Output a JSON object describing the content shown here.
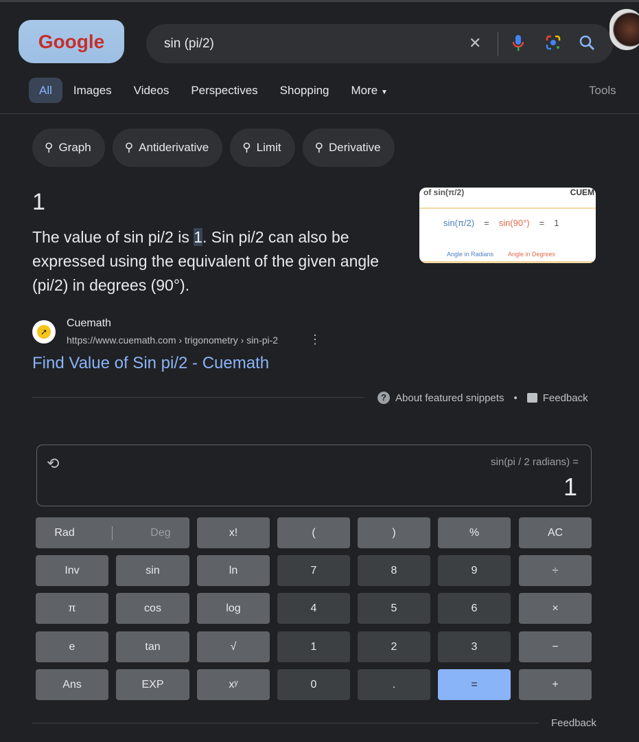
{
  "header": {
    "logo_text": "Google",
    "query": "sin (pi/2)",
    "icons": [
      "clear-icon",
      "mic-icon",
      "lens-icon",
      "search-icon"
    ]
  },
  "tabs": [
    {
      "label": "All",
      "active": true
    },
    {
      "label": "Images"
    },
    {
      "label": "Videos"
    },
    {
      "label": "Perspectives"
    },
    {
      "label": "Shopping"
    },
    {
      "label": "More"
    }
  ],
  "tools_label": "Tools",
  "chips": [
    "Graph",
    "Antiderivative",
    "Limit",
    "Derivative"
  ],
  "snippet": {
    "answer": "1",
    "text_before": "The value of sin pi/2 is ",
    "highlight": "1",
    "text_after": ". Sin pi/2 can also be expressed using the equivalent of the given angle (pi/2) in degrees (90°).",
    "image": {
      "top": "of sin(π/2)",
      "brand": "CUEM",
      "formula_left": "sin(π/2)",
      "eq": "=",
      "formula_mid": "sin(90°)",
      "formula_right": "1",
      "label_rad": "Angle in Radians",
      "label_deg": "Angle in Degrees"
    },
    "source_name": "Cuemath",
    "source_url": "https://www.cuemath.com › trigonometry › sin-pi-2",
    "link_title": "Find Value of Sin pi/2 - Cuemath",
    "about": "About featured snippets",
    "dot": "•",
    "feedback": "Feedback"
  },
  "calculator": {
    "expression": "sin(pi / 2 radians) =",
    "result": "1",
    "rad": "Rad",
    "deg": "Deg",
    "buttons": [
      [
        "x!",
        "(",
        ")",
        "%",
        "AC"
      ],
      [
        "Inv",
        "sin",
        "ln",
        "7",
        "8",
        "9",
        "÷"
      ],
      [
        "π",
        "cos",
        "log",
        "4",
        "5",
        "6",
        "×"
      ],
      [
        "e",
        "tan",
        "√",
        "1",
        "2",
        "3",
        "−"
      ],
      [
        "Ans",
        "EXP",
        "xʸ",
        "0",
        ".",
        "=",
        "+"
      ]
    ],
    "feedback": "Feedback",
    "colors": {
      "function": "#5f6368",
      "digit": "#3c4043",
      "equals": "#8ab4f8"
    }
  }
}
